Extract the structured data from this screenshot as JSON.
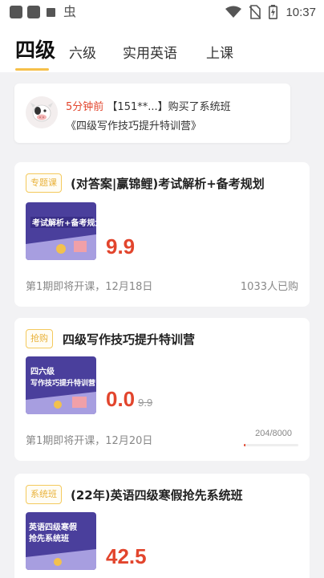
{
  "status_bar": {
    "time": "10:37",
    "notif_glyph": "虫"
  },
  "tabs": [
    {
      "label": "四级",
      "active": true
    },
    {
      "label": "六级",
      "active": false
    },
    {
      "label": "实用英语",
      "active": false
    },
    {
      "label": "上课",
      "active": false
    }
  ],
  "notice": {
    "time": "5分钟前",
    "text": "【151**...】购买了系统班",
    "course": "《四级写作技巧提升特训营》"
  },
  "courses": [
    {
      "badge": "专题课",
      "title": "(对答案|赢锦鲤)考试解析+备考规划",
      "thumb_lines": [
        "考试解析+备考规划"
      ],
      "price": "9.9",
      "old_price": "",
      "date": "第1期即将开课，12月18日",
      "count": "1033人已购"
    },
    {
      "badge": "抢购",
      "title": "四级写作技巧提升特训营",
      "thumb_lines": [
        "四六级",
        "写作技巧提升特训营"
      ],
      "price": "0.0",
      "old_price": "9.9",
      "date": "第1期即将开课，12月20日",
      "progress": {
        "label": "204/8000",
        "fraction": 0.0255
      }
    },
    {
      "badge": "系统班",
      "title": "(22年)英语四级寒假抢先系统班",
      "thumb_lines": [
        "英语四级寒假",
        "抢先系统班"
      ],
      "price": "42.5",
      "old_price": ""
    }
  ],
  "colors": {
    "accent": "#e2452d",
    "tab_underline": "#f6c04a",
    "badge": "#e9b23a",
    "thumb_bg": "#4a3f9c"
  }
}
